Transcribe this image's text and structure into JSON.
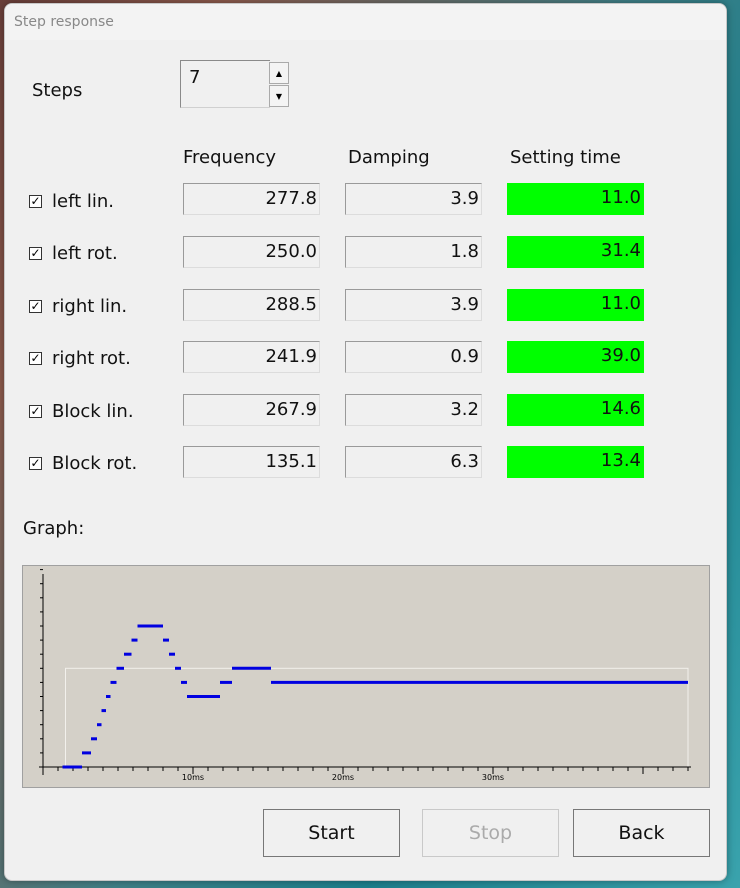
{
  "window": {
    "title": "Step response"
  },
  "steps": {
    "label": "Steps",
    "value": "7",
    "up_glyph": "▲",
    "down_glyph": "▼"
  },
  "columns": {
    "frequency": "Frequency",
    "damping": "Damping",
    "setting_time": "Setting time"
  },
  "rows": [
    {
      "label": "left lin.",
      "checked": true,
      "frequency": "277.8",
      "damping": "3.9",
      "setting_time": "11.0"
    },
    {
      "label": "left rot.",
      "checked": true,
      "frequency": "250.0",
      "damping": "1.8",
      "setting_time": "31.4"
    },
    {
      "label": "right lin.",
      "checked": true,
      "frequency": "288.5",
      "damping": "3.9",
      "setting_time": "11.0"
    },
    {
      "label": "right rot.",
      "checked": true,
      "frequency": "241.9",
      "damping": "0.9",
      "setting_time": "39.0"
    },
    {
      "label": "Block lin.",
      "checked": true,
      "frequency": "267.9",
      "damping": "3.2",
      "setting_time": "14.6"
    },
    {
      "label": "Block rot.",
      "checked": true,
      "frequency": "135.1",
      "damping": "6.3",
      "setting_time": "13.4"
    }
  ],
  "check_glyph": "✓",
  "graph": {
    "label": "Graph:",
    "x_ticks": [
      "10ms",
      "20ms",
      "30ms"
    ],
    "setpoint_level": 7,
    "response": [
      {
        "t0": 1.3,
        "t1": 2.6,
        "y": 0
      },
      {
        "t0": 2.6,
        "t1": 3.2,
        "y": 1
      },
      {
        "t0": 3.2,
        "t1": 3.6,
        "y": 2
      },
      {
        "t0": 3.6,
        "t1": 3.9,
        "y": 3
      },
      {
        "t0": 3.9,
        "t1": 4.2,
        "y": 4
      },
      {
        "t0": 4.2,
        "t1": 4.5,
        "y": 5
      },
      {
        "t0": 4.5,
        "t1": 4.9,
        "y": 6
      },
      {
        "t0": 4.9,
        "t1": 5.4,
        "y": 7
      },
      {
        "t0": 5.4,
        "t1": 5.9,
        "y": 8
      },
      {
        "t0": 5.9,
        "t1": 6.3,
        "y": 9
      },
      {
        "t0": 6.3,
        "t1": 8.0,
        "y": 10
      },
      {
        "t0": 8.0,
        "t1": 8.4,
        "y": 9
      },
      {
        "t0": 8.4,
        "t1": 8.8,
        "y": 8
      },
      {
        "t0": 8.8,
        "t1": 9.2,
        "y": 7
      },
      {
        "t0": 9.2,
        "t1": 9.6,
        "y": 6
      },
      {
        "t0": 9.6,
        "t1": 11.8,
        "y": 5
      },
      {
        "t0": 11.8,
        "t1": 12.6,
        "y": 6
      },
      {
        "t0": 12.6,
        "t1": 15.2,
        "y": 7
      },
      {
        "t0": 15.2,
        "t1": 43.0,
        "y": 6
      }
    ],
    "line_color": "#0000e0",
    "setpoint_color": "#f2f0ec"
  },
  "buttons": {
    "start": "Start",
    "stop": "Stop",
    "back": "Back"
  }
}
